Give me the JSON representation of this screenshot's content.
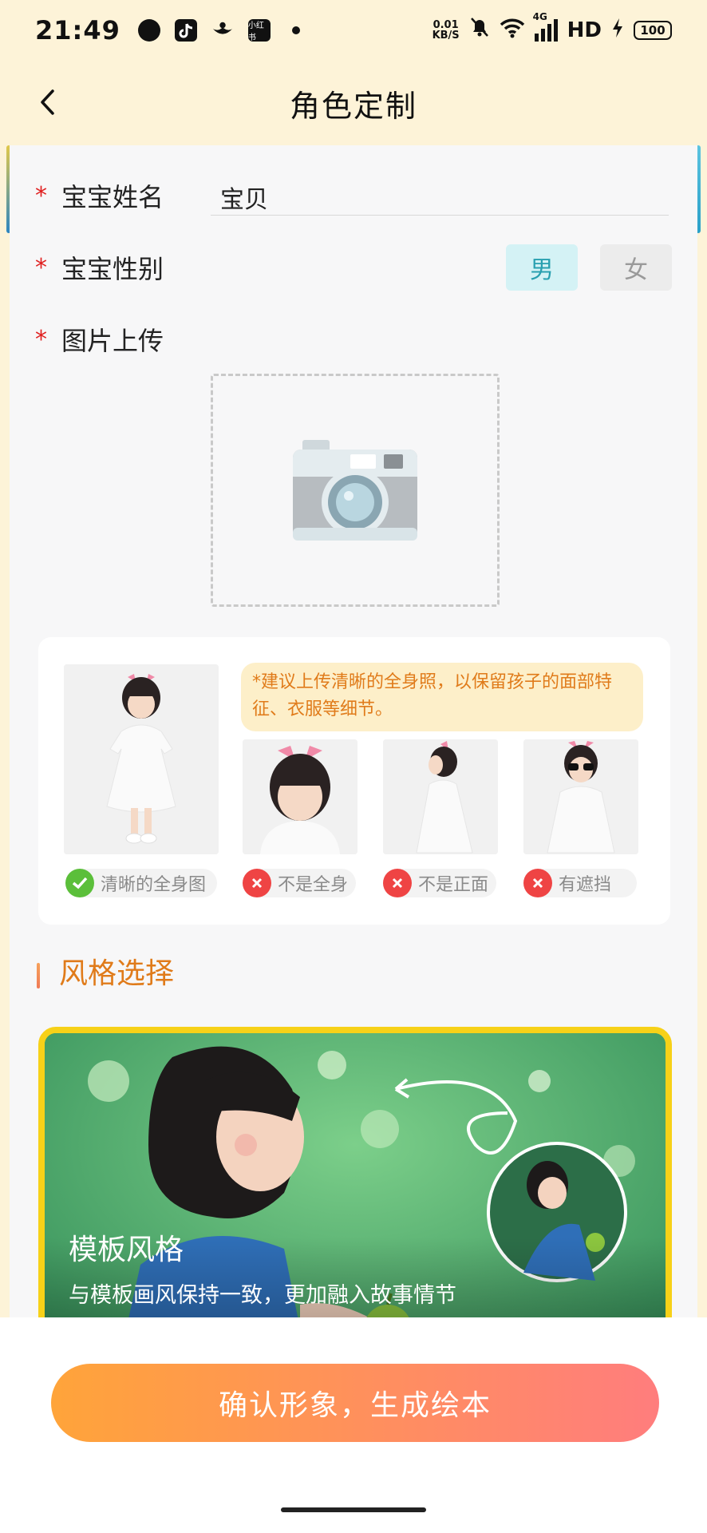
{
  "status_bar": {
    "time": "21:49",
    "speed_value": "0.01",
    "speed_unit": "KB/S",
    "network": "4G",
    "hd": "HD",
    "battery": "100",
    "icons": [
      "chat-bubble-icon",
      "tiktok-icon",
      "bird-app-icon",
      "xiaohongshu-icon",
      "dot-icon",
      "mute-bell-icon",
      "wifi-icon",
      "signal-icon",
      "charging-icon"
    ],
    "xhs_label": "小红书"
  },
  "header": {
    "title": "角色定制",
    "back_icon": "chevron-left-icon"
  },
  "form": {
    "name_label": "宝宝姓名",
    "name_value": "宝贝",
    "gender_label": "宝宝性别",
    "gender_male": "男",
    "gender_female": "女",
    "gender_selected": "男",
    "upload_label": "图片上传",
    "required_mark": "*",
    "upload_icon": "camera-icon"
  },
  "guide": {
    "tip": "*建议上传清晰的全身照，以保留孩子的面部特征、衣服等细节。",
    "examples": [
      {
        "label": "清晰的全身图",
        "ok": true
      },
      {
        "label": "不是全身",
        "ok": false
      },
      {
        "label": "不是正面",
        "ok": false
      },
      {
        "label": "有遮挡",
        "ok": false
      }
    ]
  },
  "style_section": {
    "title": "风格选择",
    "card_name": "模板风格",
    "card_desc": "与模板画风保持一致，更加融入故事情节"
  },
  "confirm_button": "确认形象，生成绘本",
  "colors": {
    "header_bg": "#fdf3d8",
    "accent_orange": "#e07b1a",
    "male_selected": "#29a0b0",
    "card_border": "#f7d118",
    "button_start": "#ffa43a",
    "button_end": "#ff7d7d"
  }
}
